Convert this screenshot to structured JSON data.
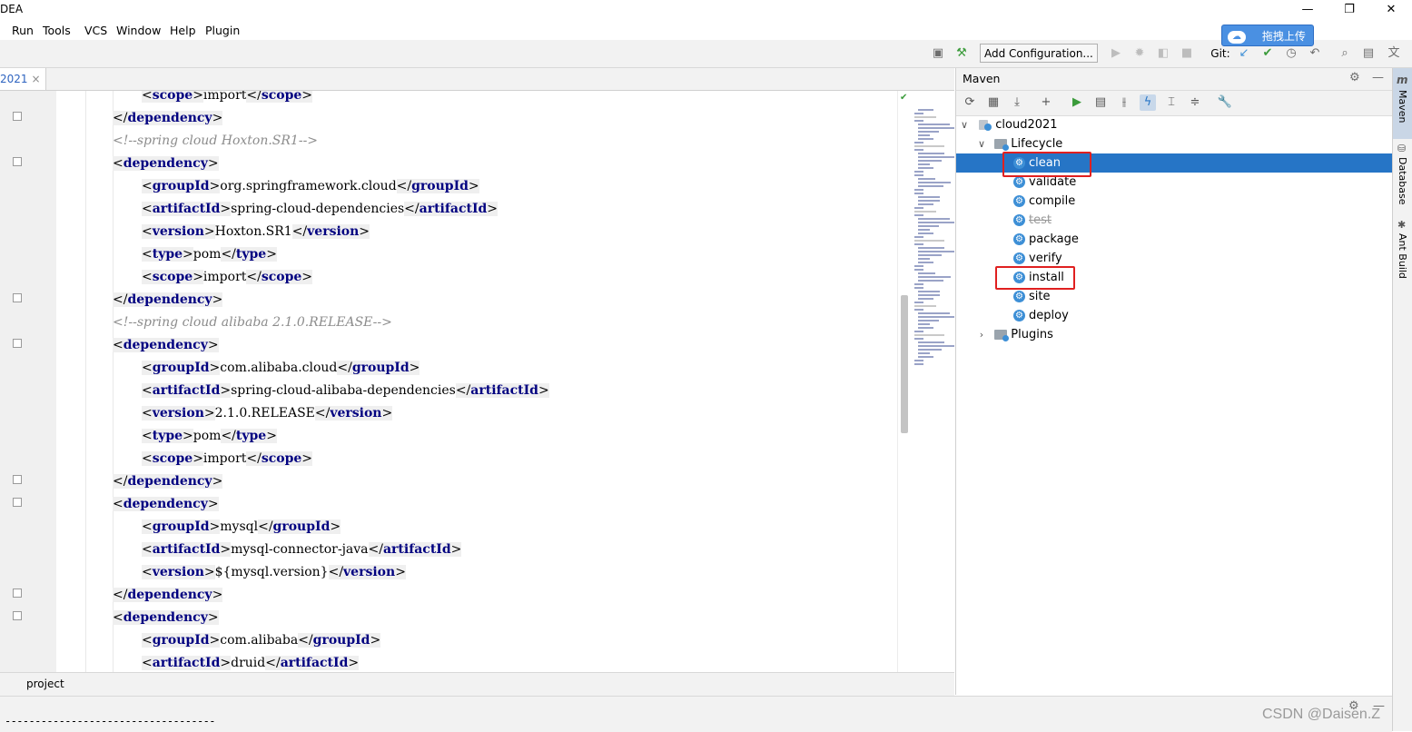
{
  "window": {
    "title": "DEA",
    "minimize": "—",
    "maximize": "❐",
    "close": "✕"
  },
  "menu": [
    "Run",
    "Tools",
    "VCS",
    "Window",
    "Help",
    "Plugin"
  ],
  "toolbar": {
    "run_config": "Add Configuration...",
    "git_label": "Git:",
    "upload_label": "拖拽上传"
  },
  "editor": {
    "tab_label": "2021",
    "tab_close": "×",
    "lines": [
      {
        "indent": 1,
        "tag": "scope",
        "text": "import"
      },
      {
        "indent": 0,
        "close": "dependency"
      },
      {
        "indent": 0,
        "comment": "<!--spring cloud Hoxton.SR1-->"
      },
      {
        "indent": 0,
        "open": "dependency"
      },
      {
        "indent": 1,
        "tag": "groupId",
        "text": "org.springframework.cloud"
      },
      {
        "indent": 1,
        "tag": "artifactId",
        "text": "spring-cloud-dependencies"
      },
      {
        "indent": 1,
        "tag": "version",
        "text": "Hoxton.SR1"
      },
      {
        "indent": 1,
        "tag": "type",
        "text": "pom"
      },
      {
        "indent": 1,
        "tag": "scope",
        "text": "import"
      },
      {
        "indent": 0,
        "close": "dependency"
      },
      {
        "indent": 0,
        "comment": "<!--spring cloud alibaba 2.1.0.RELEASE-->"
      },
      {
        "indent": 0,
        "open": "dependency"
      },
      {
        "indent": 1,
        "tag": "groupId",
        "text": "com.alibaba.cloud"
      },
      {
        "indent": 1,
        "tag": "artifactId",
        "text": "spring-cloud-alibaba-dependencies"
      },
      {
        "indent": 1,
        "tag": "version",
        "text": "2.1.0.RELEASE"
      },
      {
        "indent": 1,
        "tag": "type",
        "text": "pom"
      },
      {
        "indent": 1,
        "tag": "scope",
        "text": "import"
      },
      {
        "indent": 0,
        "close": "dependency"
      },
      {
        "indent": 0,
        "open": "dependency"
      },
      {
        "indent": 1,
        "tag": "groupId",
        "text": "mysql"
      },
      {
        "indent": 1,
        "tag": "artifactId",
        "text": "mysql-connector-java"
      },
      {
        "indent": 1,
        "tag": "version",
        "text": "${mysql.version}"
      },
      {
        "indent": 0,
        "close": "dependency"
      },
      {
        "indent": 0,
        "open": "dependency"
      },
      {
        "indent": 1,
        "tag": "groupId",
        "text": "com.alibaba"
      },
      {
        "indent": 1,
        "tag": "artifactId",
        "text": "druid"
      }
    ]
  },
  "bottom": {
    "tool_label": "project",
    "status_dashes": "-----------------------------------"
  },
  "maven": {
    "title": "Maven",
    "root": "cloud2021",
    "lifecycle_label": "Lifecycle",
    "phases": [
      {
        "name": "clean",
        "selected": true,
        "disabled": false
      },
      {
        "name": "validate",
        "selected": false,
        "disabled": false
      },
      {
        "name": "compile",
        "selected": false,
        "disabled": false
      },
      {
        "name": "test",
        "selected": false,
        "disabled": true
      },
      {
        "name": "package",
        "selected": false,
        "disabled": false
      },
      {
        "name": "verify",
        "selected": false,
        "disabled": false
      },
      {
        "name": "install",
        "selected": false,
        "disabled": false
      },
      {
        "name": "site",
        "selected": false,
        "disabled": false
      },
      {
        "name": "deploy",
        "selected": false,
        "disabled": false
      }
    ],
    "plugins_label": "Plugins",
    "highlighted": [
      "clean",
      "install"
    ]
  },
  "side_stripe": [
    "Maven",
    "Database",
    "Ant Build"
  ],
  "watermark": "CSDN @Daisen.Z",
  "colors": {
    "selection": "#2675c6",
    "highlight_box": "#e02020",
    "xml_tag": "#000080",
    "comment": "#8c8c8c"
  }
}
